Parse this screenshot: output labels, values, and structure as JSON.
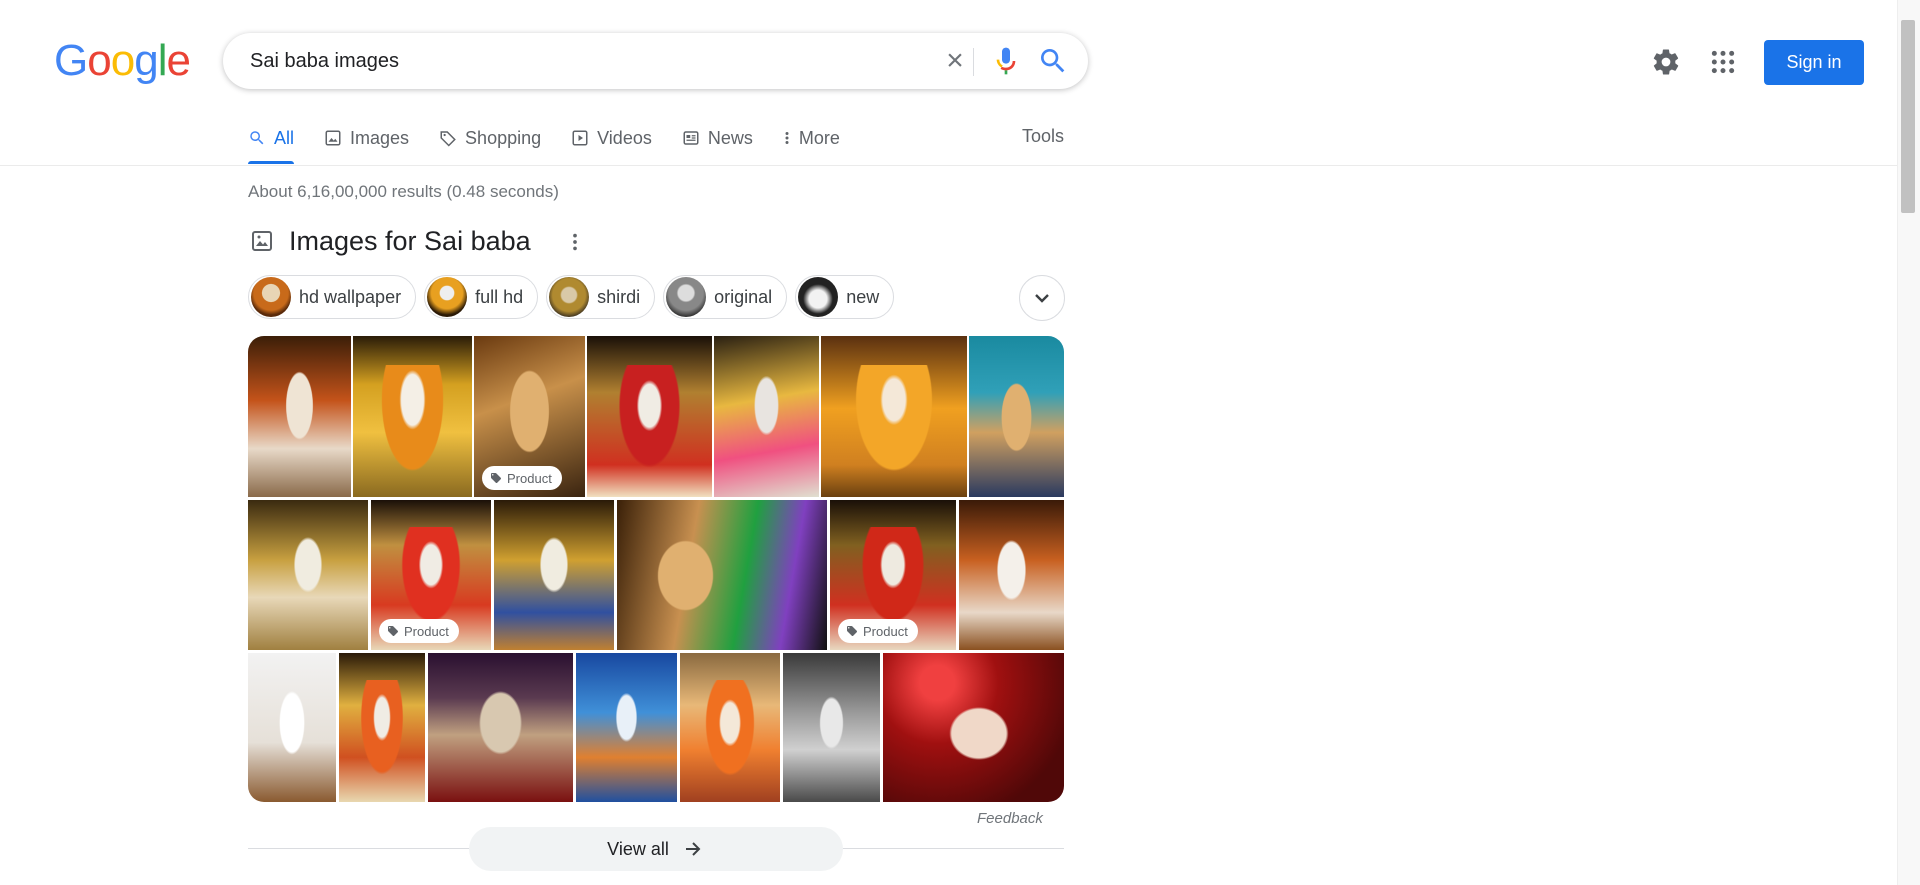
{
  "logo": {
    "text": "Google",
    "letters": [
      "G",
      "o",
      "o",
      "g",
      "l",
      "e"
    ],
    "colors": [
      "#4285f4",
      "#ea4335",
      "#fbbc05",
      "#4285f4",
      "#34a853",
      "#ea4335"
    ]
  },
  "search": {
    "query": "Sai baba images",
    "clear_icon": "close-icon",
    "voice_icon": "mic-icon",
    "search_icon": "search-icon"
  },
  "header": {
    "settings_icon": "gear-icon",
    "apps_icon": "apps-grid-icon",
    "signin_label": "Sign in"
  },
  "tabs": [
    {
      "label": "All",
      "icon": "search-icon",
      "active": true
    },
    {
      "label": "Images",
      "icon": "image-icon"
    },
    {
      "label": "Shopping",
      "icon": "tag-icon"
    },
    {
      "label": "Videos",
      "icon": "play-icon"
    },
    {
      "label": "News",
      "icon": "news-icon"
    },
    {
      "label": "More",
      "icon": "more-vert-icon"
    }
  ],
  "tools_label": "Tools",
  "stats": "About 6,16,00,000 results (0.48 seconds)",
  "images_section": {
    "title": "Images for Sai baba",
    "chips": [
      {
        "label": "hd wallpaper"
      },
      {
        "label": "full hd"
      },
      {
        "label": "shirdi"
      },
      {
        "label": "original"
      },
      {
        "label": "new"
      }
    ],
    "product_tag": "Product",
    "feedback": "Feedback",
    "view_all": "View all"
  },
  "colors": {
    "accent": "#1a73e8",
    "text": "#202124",
    "muted": "#70757a"
  }
}
